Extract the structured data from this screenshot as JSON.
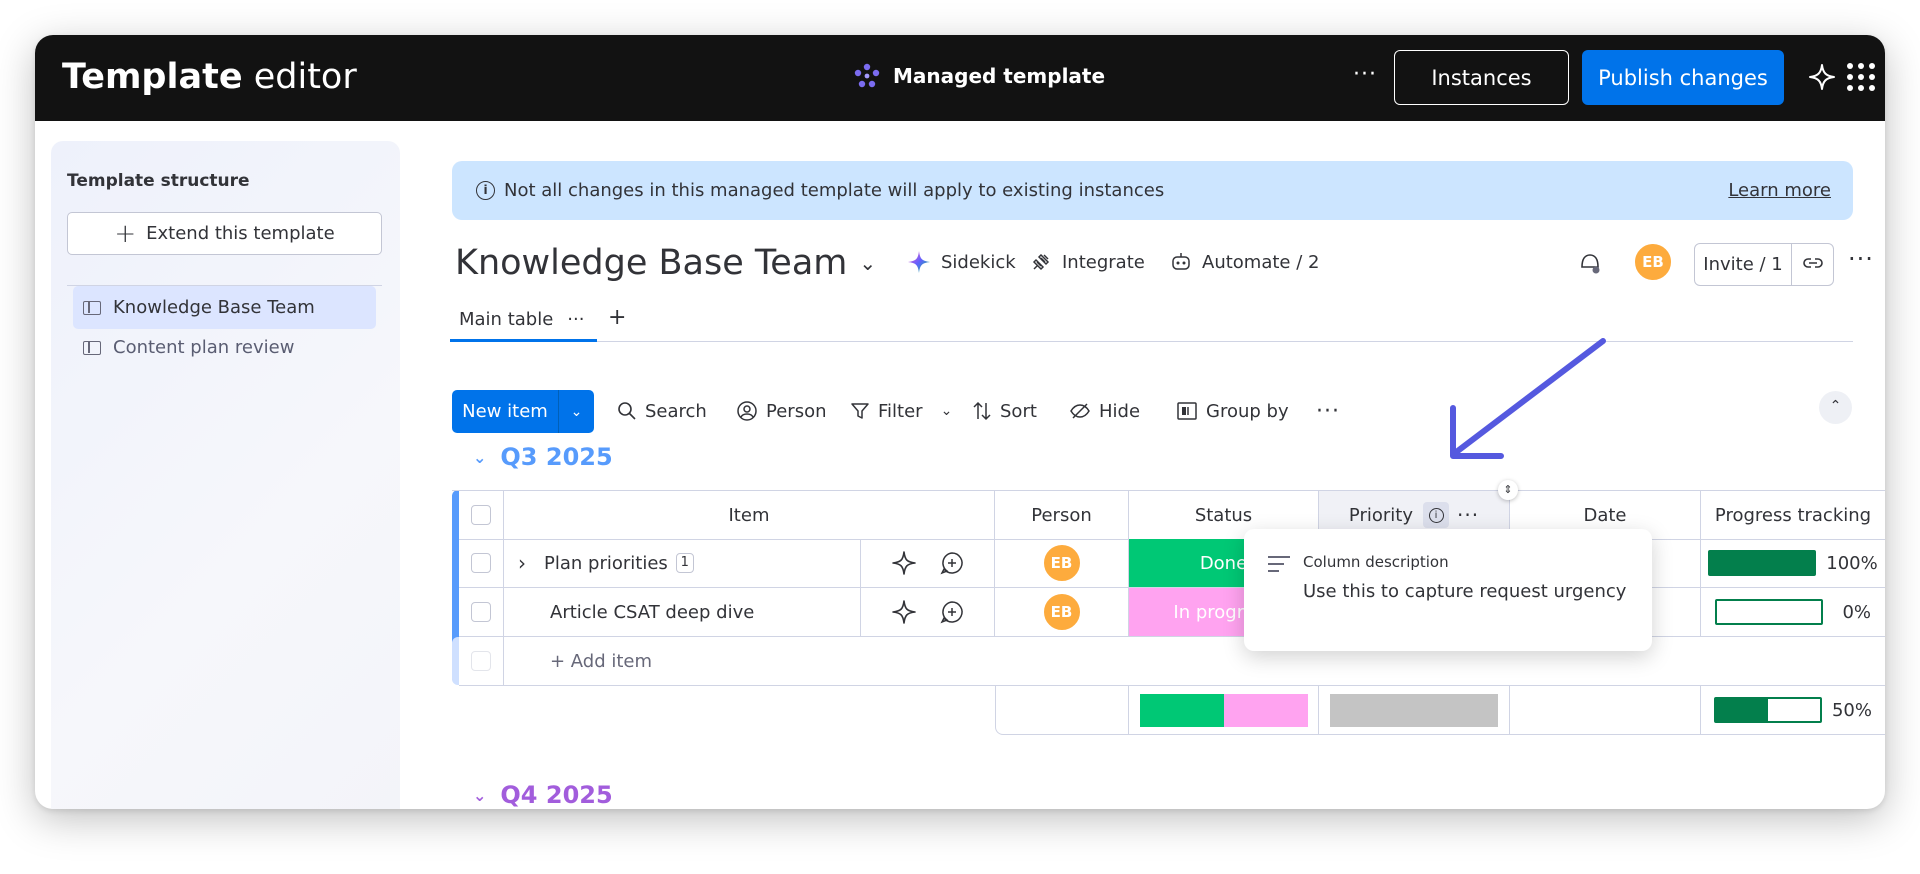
{
  "topbar": {
    "title_bold": "Template",
    "title_light": "editor",
    "managed_label": "Managed template",
    "more": "···",
    "instances_label": "Instances",
    "publish_label": "Publish changes"
  },
  "sidebar": {
    "title": "Template structure",
    "extend_label": "Extend this template",
    "items": [
      {
        "label": "Knowledge Base Team"
      },
      {
        "label": "Content plan review"
      }
    ]
  },
  "banner": {
    "text": "Not all changes in this managed template will apply to existing instances",
    "link": "Learn more"
  },
  "board": {
    "title": "Knowledge Base Team",
    "sidekick": "Sidekick",
    "integrate": "Integrate",
    "automate": "Automate / 2",
    "avatar_initials": "EB",
    "invite": "Invite / 1",
    "tab_main": "Main table",
    "tab_dots": "···",
    "tab_plus": "+"
  },
  "toolbar": {
    "new_item": "New item",
    "search": "Search",
    "person": "Person",
    "filter": "Filter",
    "sort": "Sort",
    "hide": "Hide",
    "group_by": "Group by",
    "more": "···"
  },
  "groups": [
    {
      "name": "Q3 2025",
      "color": "#579bfc"
    },
    {
      "name": "Q4 2025",
      "color": "#a25ddc"
    }
  ],
  "table": {
    "columns": {
      "item": "Item",
      "person": "Person",
      "status": "Status",
      "priority": "Priority",
      "date": "Date",
      "progress": "Progress tracking"
    },
    "rows": [
      {
        "name": "Plan priorities",
        "count": "1",
        "person": "EB",
        "status": "Done",
        "status_color": "#00c875",
        "progress_pct": 100,
        "progress_label": "100%"
      },
      {
        "name": "Article CSAT deep dive",
        "count": "",
        "person": "EB",
        "status": "In progress",
        "status_color": "#ffa3f0",
        "progress_pct": 0,
        "progress_label": "0%"
      }
    ],
    "add_item": "+ Add item",
    "summary": {
      "status_done_fraction": 0.5,
      "progress_pct": 50,
      "progress_label": "50%"
    }
  },
  "popover": {
    "title": "Column description",
    "text": "Use this to capture request urgency"
  },
  "colors": {
    "accent": "#0073ea",
    "done": "#00c875",
    "progress": "#037f4c",
    "annotation_arrow": "#5559df"
  }
}
